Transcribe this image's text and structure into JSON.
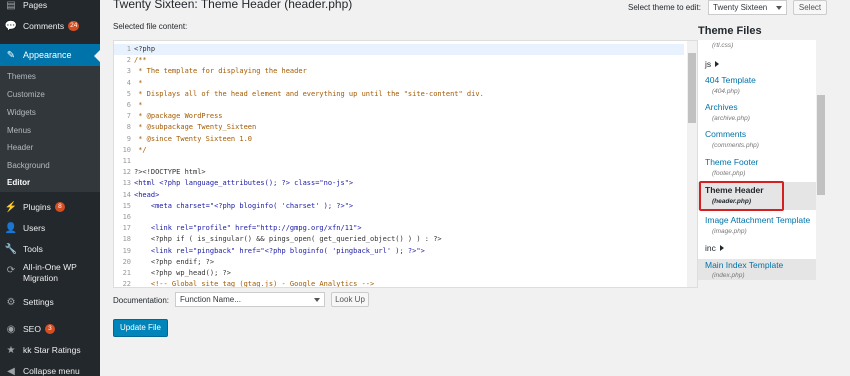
{
  "sidebar": {
    "items": [
      {
        "label": "Pages",
        "icon": "pages-icon"
      },
      {
        "label": "Comments",
        "icon": "comments-icon",
        "badge": "24"
      },
      {
        "label": "Appearance",
        "icon": "appearance-icon"
      },
      {
        "label": "Plugins",
        "icon": "plugins-icon",
        "badge": "8"
      },
      {
        "label": "Users",
        "icon": "users-icon"
      },
      {
        "label": "Tools",
        "icon": "tools-icon"
      },
      {
        "label": "All-in-One WP",
        "label2": "Migration",
        "icon": "migration-icon"
      },
      {
        "label": "Settings",
        "icon": "settings-icon"
      },
      {
        "label": "SEO",
        "icon": "seo-icon",
        "badge": "3"
      },
      {
        "label": "kk Star Ratings",
        "icon": "star-icon"
      },
      {
        "label": "Collapse menu",
        "icon": "collapse-icon"
      }
    ],
    "submenu": [
      "Themes",
      "Customize",
      "Widgets",
      "Menus",
      "Header",
      "Background",
      "Editor"
    ]
  },
  "header": {
    "title": "Twenty Sixteen: Theme Header (header.php)",
    "select_label": "Select theme to edit:",
    "select_value": "Twenty Sixteen",
    "select_button": "Select"
  },
  "editor": {
    "label": "Selected file content:",
    "lines": [
      "<?php",
      "/**",
      " * The template for displaying the header",
      " *",
      " * Displays all of the head element and everything up until the \"site-content\" div.",
      " *",
      " * @package WordPress",
      " * @subpackage Twenty_Sixteen",
      " * @since Twenty Sixteen 1.0",
      " */",
      "",
      "?><!DOCTYPE html>",
      "<html <?php language_attributes(); ?> class=\"no-js\">",
      "<head>",
      "    <meta charset=\"<?php bloginfo( 'charset' ); ?>\">",
      "",
      "    <link rel=\"profile\" href=\"http://gmpg.org/xfn/11\">",
      "    <?php if ( is_singular() && pings_open( get_queried_object() ) ) : ?>",
      "    <link rel=\"pingback\" href=\"<?php bloginfo( 'pingback_url' ); ?>\">",
      "    <?php endif; ?>",
      "    <?php wp_head(); ?>",
      "    <!-- Global site tag (gtag.js) - Google Analytics -->"
    ]
  },
  "files": {
    "title": "Theme Files",
    "entries": [
      {
        "kind": "filename",
        "text": "(rtl.css)"
      },
      {
        "kind": "folder",
        "text": "js"
      },
      {
        "kind": "link",
        "text": "404 Template",
        "file": "(404.php)"
      },
      {
        "kind": "link",
        "text": "Archives",
        "file": "(archive.php)"
      },
      {
        "kind": "link",
        "text": "Comments",
        "file": "(comments.php)"
      },
      {
        "kind": "link",
        "text": "Theme Footer",
        "file": "(footer.php)"
      },
      {
        "kind": "current",
        "text": "Theme Header",
        "file": "(header.php)"
      },
      {
        "kind": "link",
        "text": "Image Attachment Template",
        "file": "(image.php)"
      },
      {
        "kind": "folder",
        "text": "inc"
      },
      {
        "kind": "link",
        "text": "Main Index Template",
        "file": "(index.php)"
      }
    ]
  },
  "docs": {
    "label": "Documentation:",
    "select_value": "Function Name...",
    "lookup_button": "Look Up"
  },
  "update_button": "Update File",
  "colors": {
    "admin_bar": "#23282d",
    "accent": "#0073aa",
    "primary_button": "#0085ba",
    "highlight_border": "#d42020",
    "badge": "#d54e21"
  }
}
